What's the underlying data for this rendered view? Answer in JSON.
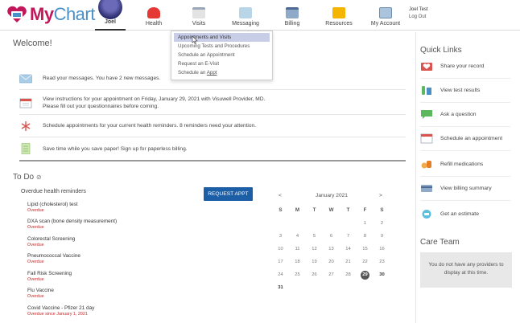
{
  "header": {
    "logo_text_a": "My",
    "logo_text_b": "Chart",
    "nav": [
      {
        "label": "Joel",
        "icon": "avatar-icon"
      },
      {
        "label": "Health",
        "icon": "heart-icon"
      },
      {
        "label": "Visits",
        "icon": "calendar-icon"
      },
      {
        "label": "Messaging",
        "icon": "envelope-icon"
      },
      {
        "label": "Billing",
        "icon": "credit-card-icon"
      },
      {
        "label": "Resources",
        "icon": "book-icon"
      },
      {
        "label": "My Account",
        "icon": "id-card-icon"
      }
    ],
    "user_name": "Joel Test",
    "logout": "Log Out"
  },
  "dropdown": {
    "items": [
      "Appointments and Visits",
      "Upcoming Tests and Procedures",
      "Schedule an Appointment",
      "Request an E-Visit"
    ],
    "last_prefix": "Schedule an ",
    "last_link": "Appt"
  },
  "welcome": "Welcome!",
  "messages": [
    {
      "text": "Read your messages. You have 2 new messages.",
      "icon": "envelope-icon"
    },
    {
      "text": "View instructions for your appointment on Friday, January 29, 2021 with Visuwell Provider, MD.",
      "text2": "Please fill out your questionnaires before coming.",
      "icon": "calendar-icon"
    },
    {
      "text": "Schedule appointments for your current health reminders. 8 reminders need your attention.",
      "icon": "caduceus-icon"
    },
    {
      "text": "Save time while you save paper! Sign up for paperless billing.",
      "icon": "paper-icon"
    }
  ],
  "todo": {
    "title": "To Do",
    "eye": "⊘",
    "subtitle": "Overdue health reminders",
    "button": "REQUEST APPT",
    "reminders": [
      {
        "name": "Lipid (cholesterol) test",
        "status": "Overdue"
      },
      {
        "name": "DXA scan (bone density measurement)",
        "status": "Overdue"
      },
      {
        "name": "Colorectal Screening",
        "status": "Overdue"
      },
      {
        "name": "Pneumococcal Vaccine",
        "status": "Overdue"
      },
      {
        "name": "Fall Risk Screening",
        "status": "Overdue"
      },
      {
        "name": "Flu Vaccine",
        "status": "Overdue"
      },
      {
        "name": "Covid Vaccine - Pfizer 21 day",
        "status": "Overdue since January 1, 2021"
      }
    ]
  },
  "calendar": {
    "prev": "<",
    "next": ">",
    "month": "January 2021",
    "dow": [
      "S",
      "M",
      "T",
      "W",
      "T",
      "F",
      "S"
    ],
    "weeks": [
      [
        "",
        "",
        "",
        "",
        "",
        "1",
        "2"
      ],
      [
        "3",
        "4",
        "5",
        "6",
        "7",
        "8",
        "9"
      ],
      [
        "10",
        "11",
        "12",
        "13",
        "14",
        "15",
        "16"
      ],
      [
        "17",
        "18",
        "19",
        "20",
        "21",
        "22",
        "23"
      ],
      [
        "24",
        "25",
        "26",
        "27",
        "28",
        "29",
        "30"
      ],
      [
        "31",
        "",
        "",
        "",
        "",
        "",
        ""
      ]
    ],
    "today": "29",
    "bold": [
      "30",
      "31"
    ]
  },
  "quick_links": {
    "title": "Quick Links",
    "items": [
      {
        "label": "Share your record",
        "icon": "share-record-icon"
      },
      {
        "label": "View test results",
        "icon": "test-tube-icon"
      },
      {
        "label": "Ask a question",
        "icon": "chat-bubble-icon"
      },
      {
        "label": "Schedule an appointment",
        "icon": "calendar-icon"
      },
      {
        "label": "Refill medications",
        "icon": "pill-icon"
      },
      {
        "label": "View billing summary",
        "icon": "billing-icon"
      },
      {
        "label": "Get an estimate",
        "icon": "estimate-icon"
      }
    ]
  },
  "care_team": {
    "title": "Care Team",
    "empty_1": "You do not have any providers to",
    "empty_2": "display at this time."
  },
  "colors": {
    "brand_pink": "#c2185b",
    "brand_blue": "#4a90c8",
    "button_blue": "#1d5fa6",
    "overdue_red": "#c62828",
    "menu_highlight": "#c8cde8"
  }
}
